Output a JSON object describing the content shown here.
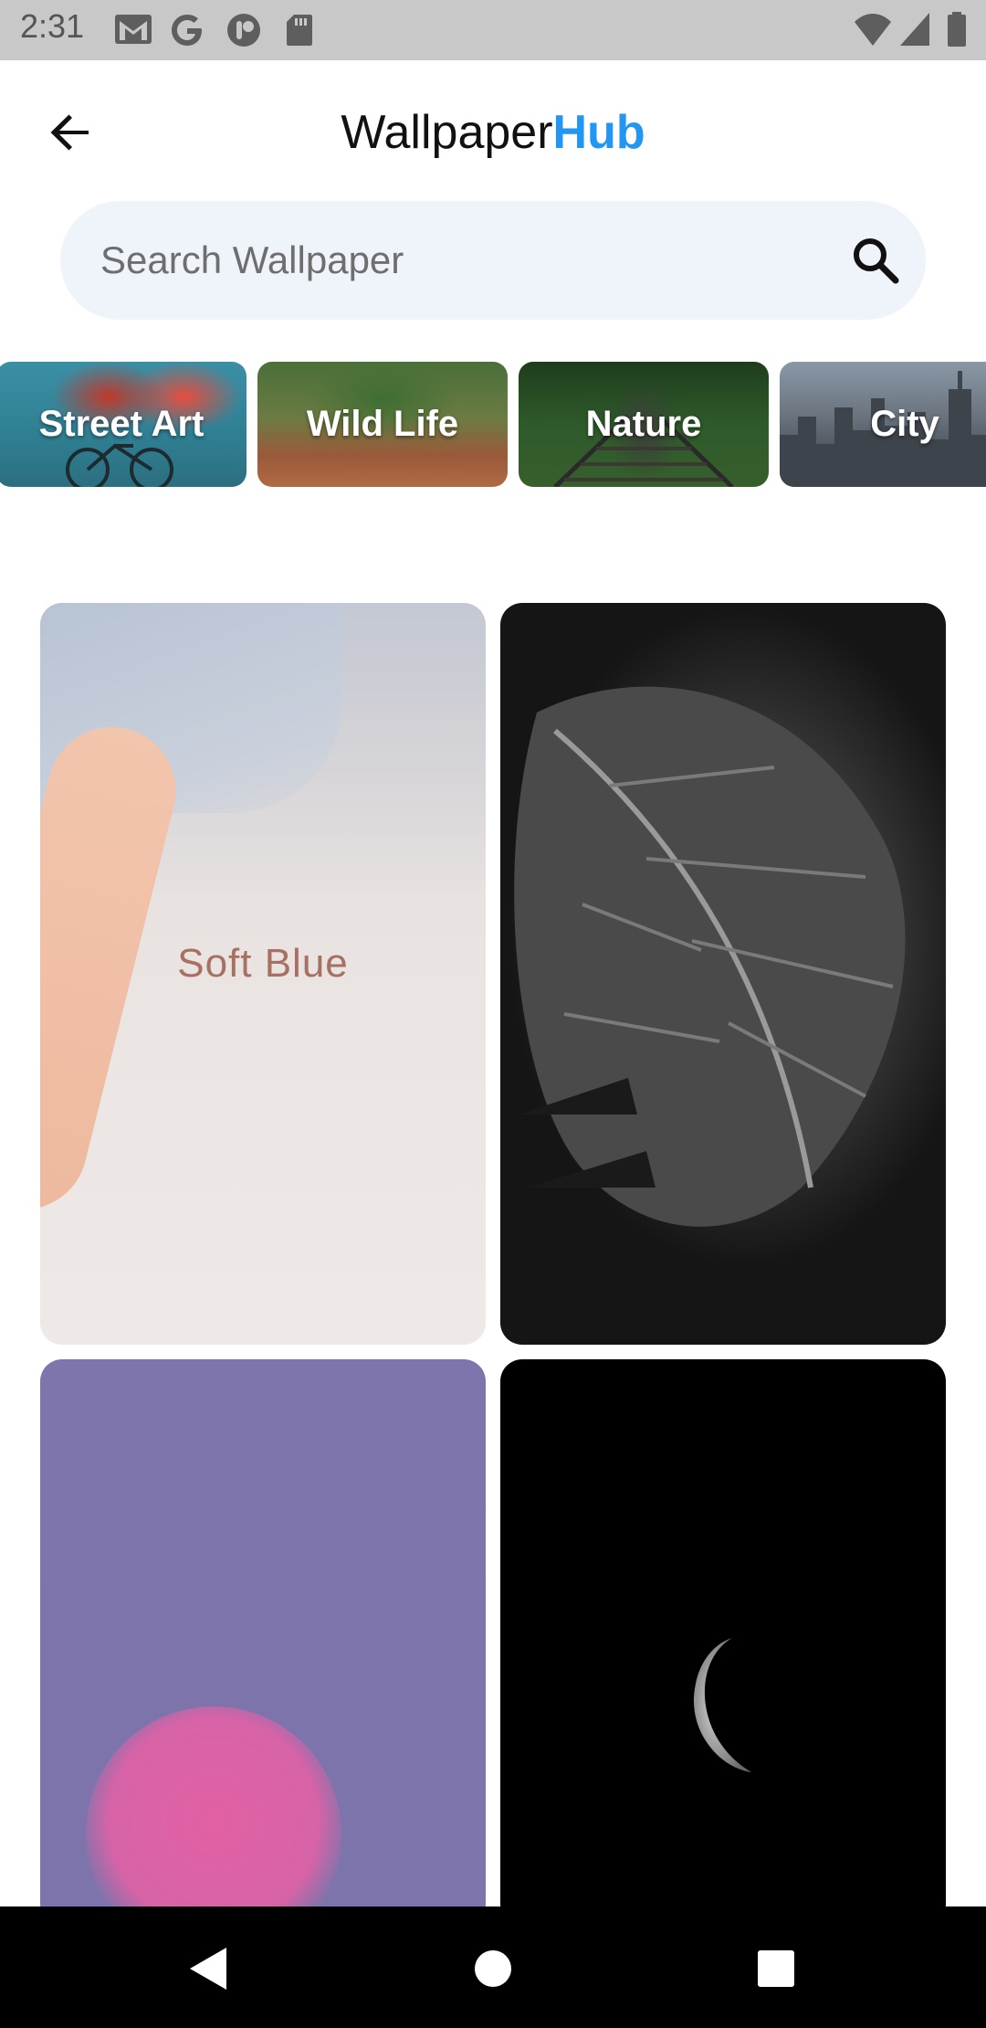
{
  "status_bar": {
    "time": "2:31",
    "left_icons": [
      "gmail-icon",
      "google-icon",
      "app-icon",
      "sd-card-icon"
    ],
    "right_icons": [
      "wifi-icon",
      "signal-icon",
      "battery-icon"
    ]
  },
  "header": {
    "title_primary": "Wallpaper",
    "title_accent": "Hub",
    "accent_color": "#2196f3"
  },
  "search": {
    "placeholder": "Search Wallpaper",
    "value": ""
  },
  "categories": [
    {
      "label": "Street Art"
    },
    {
      "label": "Wild Life"
    },
    {
      "label": "Nature"
    },
    {
      "label": "City"
    }
  ],
  "wallpapers": [
    {
      "caption": "Soft Blue"
    },
    {
      "caption": ""
    },
    {
      "caption": ""
    },
    {
      "caption": ""
    }
  ],
  "nav_bar": {
    "buttons": [
      "back-triangle-icon",
      "home-circle-icon",
      "recents-square-icon"
    ]
  }
}
